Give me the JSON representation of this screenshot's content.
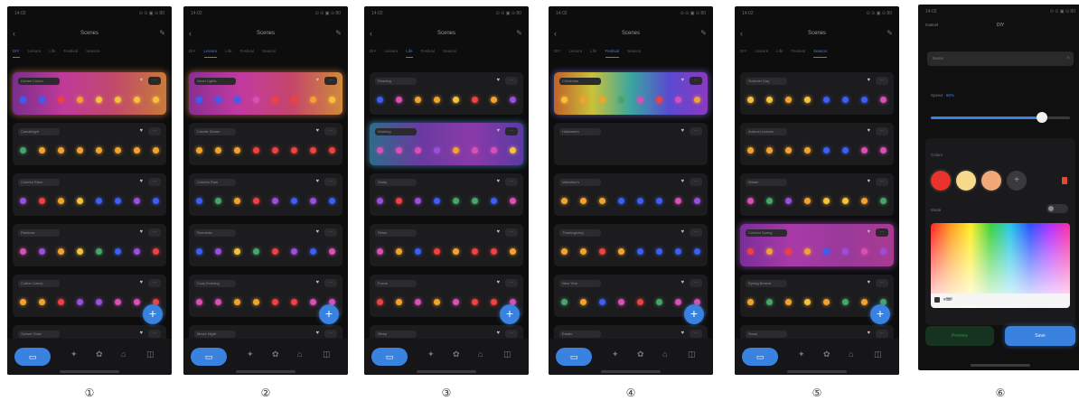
{
  "captions": [
    "①",
    "②",
    "③",
    "④",
    "⑤",
    "⑥"
  ],
  "status": {
    "time": "14:02",
    "icons": "⊙ ⊙ ▣ ⊙ 80"
  },
  "screens": [
    {
      "title": "Scenes",
      "tabs": [
        "DIY",
        "Leisure",
        "Life",
        "Festival",
        "Season"
      ],
      "active_tab": 0,
      "selected": 0,
      "scenes": [
        {
          "name": "Dream Colors",
          "colors": [
            "#3a5ff2",
            "#3a5ff2",
            "#f04040",
            "#f3a230",
            "#f7c23a",
            "#f7c23a",
            "#f7c23a",
            "#f7c23a"
          ]
        },
        {
          "name": "Candlelight",
          "colors": [
            "#46a66a",
            "#f3a230",
            "#f3a230",
            "#f3a230",
            "#f3a230",
            "#f3a230",
            "#f3a230",
            "#f3a230"
          ]
        },
        {
          "name": "Colorful Stars",
          "colors": [
            "#9b4ddb",
            "#f04040",
            "#f3a230",
            "#f7c23a",
            "#3a5ff2",
            "#3a5ff2",
            "#9b4ddb",
            "#3a5ff2"
          ]
        },
        {
          "name": "Rainbow",
          "colors": [
            "#d94fb5",
            "#9b4ddb",
            "#f3a230",
            "#f7c23a",
            "#46a66a",
            "#3a5ff2",
            "#9b4ddb",
            "#f04040"
          ]
        },
        {
          "name": "Cotton Candy",
          "colors": [
            "#f3a230",
            "#f3a230",
            "#f04040",
            "#9b4ddb",
            "#9b4ddb",
            "#d94fb5",
            "#d94fb5",
            "#f04040"
          ]
        },
        {
          "name": "Sunset Glow",
          "colors": [
            "#f3a230",
            "#f04040",
            "#9b4ddb"
          ]
        }
      ]
    },
    {
      "title": "Scenes",
      "tabs": [
        "DIY",
        "Leisure",
        "Life",
        "Festival",
        "Season"
      ],
      "active_tab": 1,
      "selected": 0,
      "scenes": [
        {
          "name": "Neon Lights",
          "colors": [
            "#3a5ff2",
            "#3a5ff2",
            "#3a5ff2",
            "#d94fb5",
            "#f04040",
            "#f04040",
            "#f3a230",
            "#f7c23a"
          ]
        },
        {
          "name": "Candle Dinner",
          "colors": [
            "#f3a230",
            "#f3a230",
            "#f3a230",
            "#f04040",
            "#f04040",
            "#f04040",
            "#f04040",
            "#f04040"
          ]
        },
        {
          "name": "Colorful Rain",
          "colors": [
            "#3a5ff2",
            "#46a66a",
            "#f3a230",
            "#f04040",
            "#9b4ddb",
            "#3a5ff2",
            "#9b4ddb",
            "#3a5ff2"
          ]
        },
        {
          "name": "Romantic",
          "colors": [
            "#3a5ff2",
            "#9b4ddb",
            "#f7c23a",
            "#46a66a",
            "#f04040",
            "#9b4ddb",
            "#3a5ff2",
            "#d94fb5"
          ]
        },
        {
          "name": "Cozy Evening",
          "colors": [
            "#d94fb5",
            "#d94fb5",
            "#f3a230",
            "#f3a230",
            "#f04040",
            "#f04040",
            "#d94fb5",
            "#d94fb5"
          ]
        },
        {
          "name": "Movie Night",
          "colors": [
            "#f3a230",
            "#f04040",
            "#9b4ddb"
          ]
        }
      ]
    },
    {
      "title": "Scenes",
      "tabs": [
        "DIY",
        "Leisure",
        "Life",
        "Festival",
        "Season"
      ],
      "active_tab": 2,
      "selected": 1,
      "scenes": [
        {
          "name": "Reading",
          "colors": [
            "#3a5ff2",
            "#d94fb5",
            "#f3a230",
            "#f3a230",
            "#f7c23a",
            "#f04040",
            "#f3a230",
            "#9b4ddb"
          ]
        },
        {
          "name": "Working",
          "colors": [
            "#d94fb5",
            "#d94fb5",
            "#d94fb5",
            "#9b4ddb",
            "#f3a230",
            "#d94fb5",
            "#d94fb5",
            "#f7c23a"
          ]
        },
        {
          "name": "Study",
          "colors": [
            "#9b4ddb",
            "#f04040",
            "#9b4ddb",
            "#3a5ff2",
            "#46a66a",
            "#46a66a",
            "#3a5ff2",
            "#d94fb5"
          ]
        },
        {
          "name": "Relax",
          "colors": [
            "#d94fb5",
            "#f3a230",
            "#3a5ff2",
            "#f04040",
            "#f3a230",
            "#f04040",
            "#f04040",
            "#f3a230"
          ]
        },
        {
          "name": "Focus",
          "colors": [
            "#f04040",
            "#f3a230",
            "#d94fb5",
            "#f3a230",
            "#d94fb5",
            "#f04040",
            "#f04040",
            "#d94fb5"
          ]
        },
        {
          "name": "Sleep",
          "colors": [
            "#f3a230",
            "#f04040",
            "#9b4ddb"
          ]
        }
      ]
    },
    {
      "title": "Scenes",
      "tabs": [
        "DIY",
        "Leisure",
        "Life",
        "Festival",
        "Season"
      ],
      "active_tab": 3,
      "selected": 0,
      "scenes": [
        {
          "name": "Christmas",
          "colors": [
            "#f7c23a",
            "#f3a230",
            "#f3a230",
            "#46a66a",
            "#d94fb5",
            "#f04040",
            "#d94fb5",
            "#f3a230"
          ]
        },
        {
          "name": "Halloween",
          "colors": []
        },
        {
          "name": "Valentine's",
          "colors": [
            "#f3a230",
            "#f3a230",
            "#f3a230",
            "#3a5ff2",
            "#3a5ff2",
            "#3a5ff2",
            "#d94fb5",
            "#9b4ddb"
          ]
        },
        {
          "name": "Thanksgiving",
          "colors": [
            "#f3a230",
            "#f3a230",
            "#f04040",
            "#f3a230",
            "#3a5ff2",
            "#3a5ff2",
            "#3a5ff2",
            "#3a5ff2"
          ]
        },
        {
          "name": "New Year",
          "colors": [
            "#46a66a",
            "#f3a230",
            "#3a5ff2",
            "#d94fb5",
            "#f04040",
            "#46a66a",
            "#d94fb5",
            "#d94fb5"
          ]
        },
        {
          "name": "Easter",
          "colors": [
            "#f3a230",
            "#f04040",
            "#9b4ddb"
          ]
        }
      ]
    },
    {
      "title": "Scenes",
      "tabs": [
        "DIY",
        "Leisure",
        "Life",
        "Festival",
        "Season"
      ],
      "active_tab": 4,
      "selected": 3,
      "scenes": [
        {
          "name": "Summer Day",
          "colors": [
            "#f7c23a",
            "#f7c23a",
            "#f3a230",
            "#f7c23a",
            "#3a5ff2",
            "#3a5ff2",
            "#3a5ff2",
            "#d94fb5"
          ]
        },
        {
          "name": "Autumn Leaves",
          "colors": [
            "#f3a230",
            "#f3a230",
            "#f3a230",
            "#f3a230",
            "#3a5ff2",
            "#3a5ff2",
            "#d94fb5",
            "#d94fb5"
          ]
        },
        {
          "name": "Winter",
          "colors": [
            "#d94fb5",
            "#46a66a",
            "#9b4ddb",
            "#f3a230",
            "#f7c23a",
            "#f7c23a",
            "#f3a230",
            "#46a66a"
          ]
        },
        {
          "name": "Colorful Spring",
          "colors": [
            "#f04040",
            "#f3a230",
            "#f04040",
            "#f3a230",
            "#3a5ff2",
            "#9b4ddb",
            "#d94fb5",
            "#9b4ddb"
          ]
        },
        {
          "name": "Spring Breeze",
          "colors": [
            "#f3a230",
            "#46a66a",
            "#f3a230",
            "#f7c23a",
            "#f3a230",
            "#46a66a",
            "#f3a230",
            "#46a66a"
          ]
        },
        {
          "name": "Snow",
          "colors": [
            "#f3a230",
            "#f04040",
            "#9b4ddb"
          ]
        }
      ]
    }
  ],
  "settings": {
    "cancel": "Cancel",
    "title": "DIY",
    "name_placeholder": "Name",
    "speed_label": "Speed",
    "speed_value": "80%",
    "speed_fraction": 0.8,
    "colors_label": "Colors",
    "swatches": [
      "#e8322a",
      "#f6d98a",
      "#f2a878"
    ],
    "mode_label": "Mode",
    "hex_value": "#ffffff",
    "preview": "Preview",
    "save": "Save"
  }
}
